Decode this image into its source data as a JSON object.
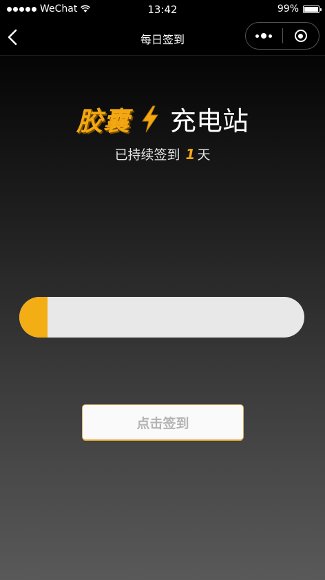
{
  "status_bar": {
    "carrier": "WeChat",
    "time": "13:42",
    "battery": "99%",
    "battery_level": 0.99
  },
  "nav": {
    "title": "每日签到",
    "back_icon": "chevron-left-icon",
    "more_icon": "more-dots-icon",
    "close_icon": "target-circle-icon"
  },
  "brand": {
    "accent_text": "胶囊",
    "main_text": "充电站",
    "icon": "lightning-bolt-icon"
  },
  "streak": {
    "prefix": "已持续签到",
    "days": "1",
    "suffix": "天"
  },
  "progress": {
    "fraction": 0.1
  },
  "checkin_button": {
    "label": "点击签到"
  },
  "colors": {
    "accent": "#f3a712",
    "track": "#e8e8e8",
    "button_bg": "#fafafa",
    "button_text": "#b3b3b3"
  }
}
